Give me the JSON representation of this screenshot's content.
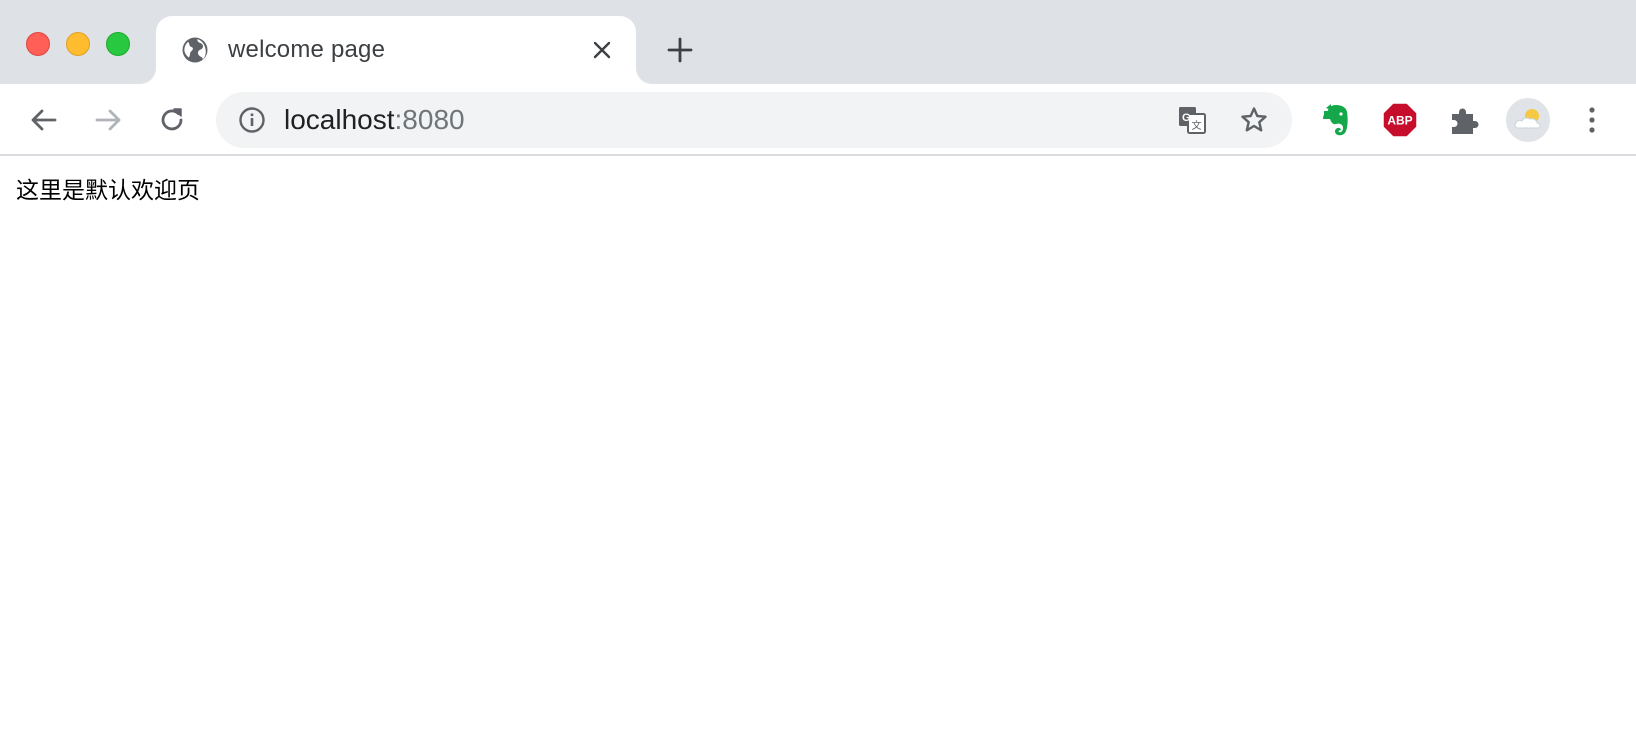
{
  "window": {
    "controls": [
      "close",
      "minimize",
      "maximize"
    ]
  },
  "tab": {
    "title": "welcome page",
    "favicon": "globe-icon"
  },
  "toolbar": {
    "back_icon": "arrow-left-icon",
    "forward_icon": "arrow-right-icon",
    "reload_icon": "reload-icon",
    "url_host": "localhost",
    "url_port": ":8080",
    "extensions": [
      "evernote-icon",
      "adblock-plus-icon",
      "extensions-puzzle-icon"
    ],
    "menu_icon": "kebab-menu-icon"
  },
  "page": {
    "body_text": "这里是默认欢迎页"
  },
  "colors": {
    "tabstrip_bg": "#dee1e6",
    "omnibox_bg": "#f1f3f4",
    "evernote_green": "#14a84a",
    "abp_red": "#c70d2c"
  }
}
